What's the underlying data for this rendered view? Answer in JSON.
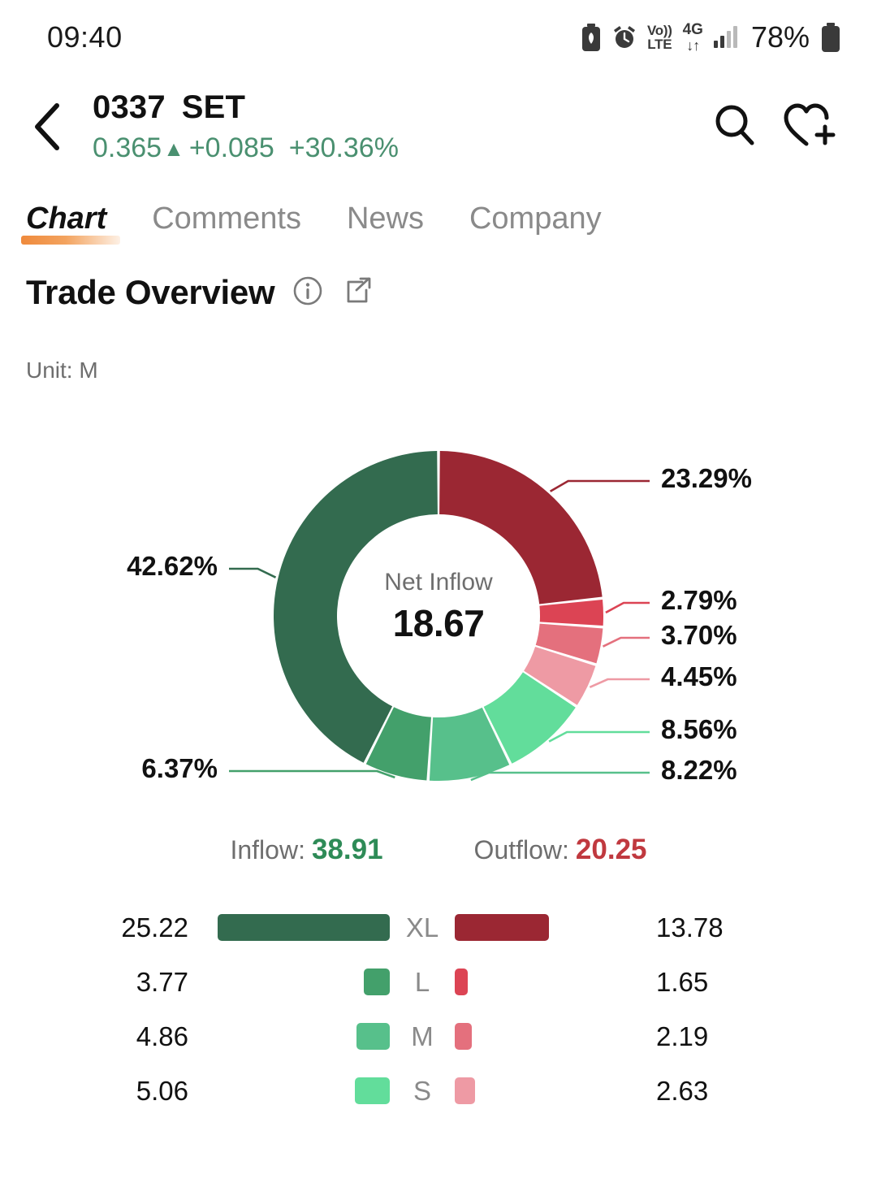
{
  "status_bar": {
    "time": "09:40",
    "battery_percent": "78%",
    "icons": [
      "battery-saver-icon",
      "alarm-icon",
      "volte-icon",
      "4g-data-icon",
      "signal-bars-icon",
      "battery-icon"
    ],
    "volte_top": "Vo))",
    "volte_bottom": "LTE",
    "network_type": "4G",
    "data_arrows": "↓↑"
  },
  "header": {
    "back_icon": "chevron-left-icon",
    "ticker_code": "0337",
    "ticker_market": "SET",
    "price": "0.365",
    "arrow": "▲",
    "change_abs": "+0.085",
    "change_pct": "+30.36%",
    "price_color": "#4A9070",
    "search_icon": "search-icon",
    "watchlist_icon": "heart-plus-icon"
  },
  "tabs": [
    {
      "label": "Chart",
      "active": true
    },
    {
      "label": "Comments",
      "active": false
    },
    {
      "label": "News",
      "active": false
    },
    {
      "label": "Company",
      "active": false
    }
  ],
  "section": {
    "title": "Trade Overview",
    "info_icon": "info-circle-icon",
    "share_icon": "share-icon",
    "unit": "Unit: M"
  },
  "donut": {
    "center_title": "Net Inflow",
    "center_value": "18.67"
  },
  "flow": {
    "inflow_label": "Inflow:",
    "inflow_value": "38.91",
    "outflow_label": "Outflow:",
    "outflow_value": "20.25"
  },
  "legend_rows": [
    {
      "category": "XL",
      "inflow": "25.22",
      "outflow": "13.78",
      "in_color": "#336B4F",
      "out_color": "#9B2733",
      "in_width": 212,
      "out_width": 116
    },
    {
      "category": "L",
      "inflow": "3.77",
      "outflow": "1.65",
      "in_color": "#43A06B",
      "out_color": "#DC4454",
      "in_width": 32,
      "out_width": 16
    },
    {
      "category": "M",
      "inflow": "4.86",
      "outflow": "2.19",
      "in_color": "#57C08B",
      "out_color": "#E4707D",
      "in_width": 41,
      "out_width": 21
    },
    {
      "category": "S",
      "inflow": "5.06",
      "outflow": "2.63",
      "in_color": "#62DD9B",
      "out_color": "#EE9AA4",
      "in_width": 43,
      "out_width": 25
    }
  ],
  "chart_data": {
    "type": "pie",
    "title": "Trade Overview",
    "subtitle": "Unit: M",
    "center_label": "Net Inflow",
    "center_value": 18.67,
    "total_inflow": 38.91,
    "total_outflow": 20.25,
    "legend_position": "bottom",
    "labels": [
      "XL Outflow",
      "L Outflow",
      "M Outflow",
      "S Outflow",
      "S Inflow",
      "M Inflow",
      "L Inflow",
      "XL Inflow"
    ],
    "values": [
      13.78,
      1.65,
      2.19,
      2.63,
      5.06,
      4.86,
      3.77,
      25.22
    ],
    "percents": [
      23.29,
      2.79,
      3.7,
      4.45,
      8.56,
      8.22,
      6.37,
      42.62
    ],
    "percent_labels": [
      "23.29%",
      "2.79%",
      "3.70%",
      "4.45%",
      "8.56%",
      "8.22%",
      "6.37%",
      "42.62%"
    ],
    "colors": [
      "#9B2733",
      "#DC4454",
      "#E4707D",
      "#EE9AA4",
      "#62DD9B",
      "#57C08B",
      "#43A06B",
      "#336B4F"
    ],
    "series": [
      {
        "name": "Inflow",
        "categories": [
          "XL",
          "L",
          "M",
          "S"
        ],
        "values": [
          25.22,
          3.77,
          4.86,
          5.06
        ],
        "percents": [
          42.62,
          6.37,
          8.22,
          8.56
        ]
      },
      {
        "name": "Outflow",
        "categories": [
          "XL",
          "L",
          "M",
          "S"
        ],
        "values": [
          13.78,
          1.65,
          2.19,
          2.63
        ],
        "percents": [
          23.29,
          2.79,
          3.7,
          4.45
        ]
      }
    ]
  }
}
